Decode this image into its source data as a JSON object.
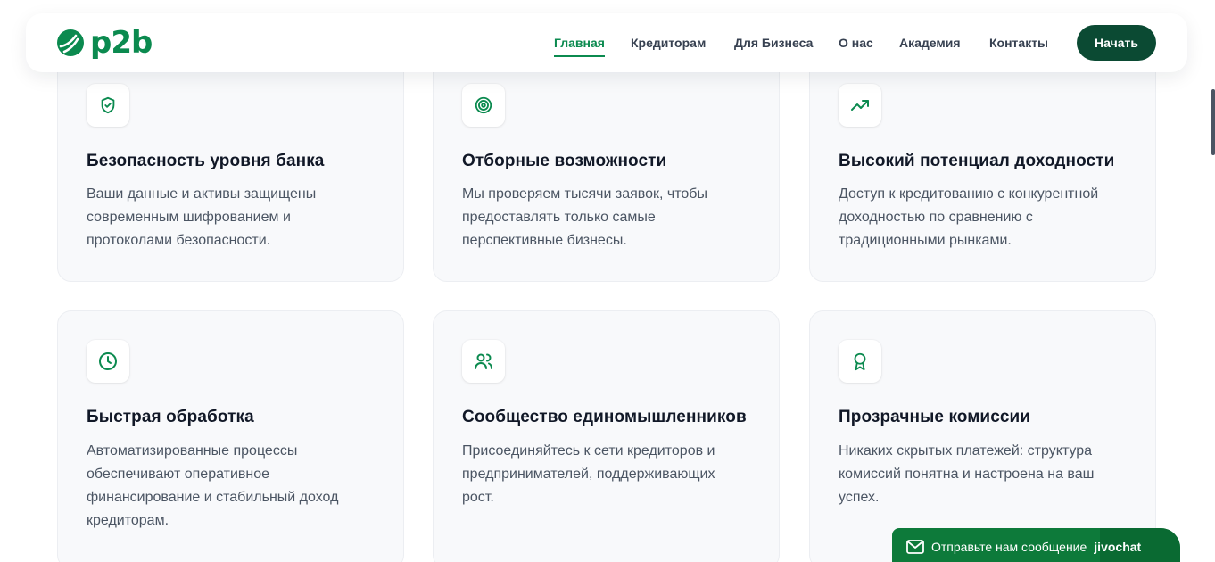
{
  "header": {
    "logo_text": "p2b",
    "nav": [
      {
        "label": "Главная",
        "active": true
      },
      {
        "label": "Кредиторам",
        "active": false
      },
      {
        "label": "Для Бизнеса",
        "active": false
      },
      {
        "label": "О нас",
        "active": false
      },
      {
        "label": "Академия",
        "active": false
      },
      {
        "label": "Контакты",
        "active": false
      }
    ],
    "cta_label": "Начать"
  },
  "features": [
    {
      "icon": "shield-check-icon",
      "title": "Безопасность уровня банка",
      "desc": "Ваши данные и активы защищены современным шифрованием и протоколами безопасности."
    },
    {
      "icon": "target-icon",
      "title": "Отборные возможности",
      "desc": "Мы проверяем тысячи заявок, чтобы предоставлять только самые перспективные бизнесы."
    },
    {
      "icon": "trending-up-icon",
      "title": "Высокий потенциал доходности",
      "desc": "Доступ к кредитованию с конкурентной доходностью по сравнению с традиционными рынками."
    },
    {
      "icon": "clock-icon",
      "title": "Быстрая обработка",
      "desc": "Автоматизированные процессы обеспечивают оперативное финансирование и стабильный доход кредиторам."
    },
    {
      "icon": "users-icon",
      "title": "Сообщество единомышленников",
      "desc": "Присоединяйтесь к сети кредиторов и предпринимателей, поддерживающих рост."
    },
    {
      "icon": "award-icon",
      "title": "Прозрачные комиссии",
      "desc": "Никаких скрытых платежей: структура комиссий понятна и настроена на ваш успех."
    }
  ],
  "chat": {
    "label": "Отправьте нам сообщение",
    "brand": "jivochat"
  },
  "colors": {
    "accent": "#0b8a4f",
    "button_dark": "#0b4a33",
    "chat_green": "#0d7a3a"
  }
}
